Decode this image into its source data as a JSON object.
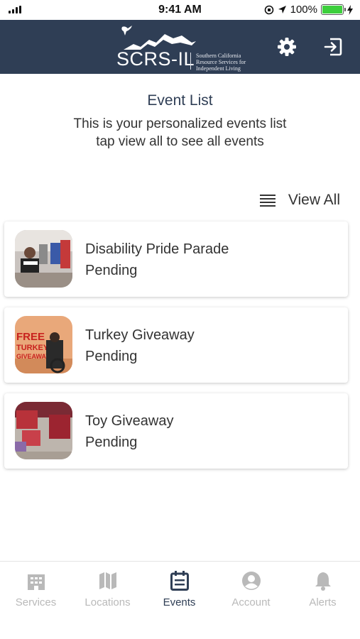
{
  "status_bar": {
    "time": "9:41 AM",
    "battery": "100%",
    "battery_level": 1.0
  },
  "header": {
    "logo_text": "SCRS-IL",
    "logo_subtitle": [
      "Southern California",
      "Resource Services for",
      "Independent Living"
    ],
    "settings_icon": "gear-icon",
    "logout_icon": "sign-out-icon"
  },
  "intro": {
    "title": "Event List",
    "line1": "This is your personalized events list",
    "line2": "tap view all to see all events"
  },
  "view_all": {
    "label": "View All",
    "icon": "list-icon"
  },
  "events": [
    {
      "title": "Disability Pride Parade",
      "status": "Pending"
    },
    {
      "title": "Turkey Giveaway",
      "status": "Pending"
    },
    {
      "title": "Toy Giveaway",
      "status": "Pending"
    }
  ],
  "nav": {
    "items": [
      {
        "label": "Services",
        "icon": "building-icon",
        "active": false
      },
      {
        "label": "Locations",
        "icon": "map-icon",
        "active": false
      },
      {
        "label": "Events",
        "icon": "calendar-icon",
        "active": true
      },
      {
        "label": "Account",
        "icon": "user-circle-icon",
        "active": false
      },
      {
        "label": "Alerts",
        "icon": "bell-icon",
        "active": false
      }
    ]
  },
  "colors": {
    "header_bg": "#2f3e55",
    "active": "#2f3e55",
    "inactive": "#b9b9b9",
    "battery": "#3ccf3c"
  }
}
